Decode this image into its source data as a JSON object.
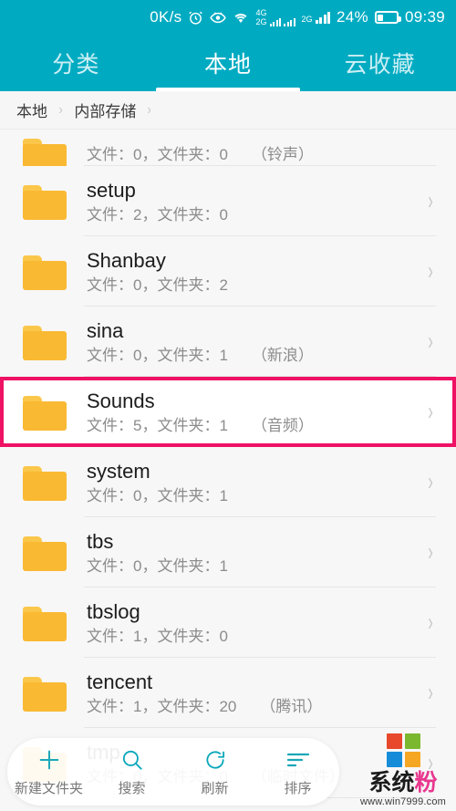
{
  "theme": {
    "accent_teal": "#00abc2",
    "folder_orange": "#f9b932",
    "highlight_pink": "#ee1164",
    "toolbar_teal": "#1aa7b8"
  },
  "statusbar": {
    "net_speed": "0K/s",
    "alarm_icon": "alarm-clock-icon",
    "eye_icon": "eye-care-icon",
    "wifi_icon": "wifi-icon",
    "sim1_label": "4G",
    "sim1_label2": "2G",
    "sim2_label": "2G",
    "battery_percent": "24%",
    "clock": "09:39"
  },
  "tabs": [
    {
      "label": "分类",
      "active": false
    },
    {
      "label": "本地",
      "active": true
    },
    {
      "label": "云收藏",
      "active": false
    }
  ],
  "breadcrumb": {
    "items": [
      "本地",
      "内部存储"
    ],
    "separator": "›"
  },
  "list": {
    "meta_prefix_files": "文件：",
    "meta_prefix_folders": "，文件夹：",
    "rows": [
      {
        "name": "",
        "files": "0",
        "folders": "0",
        "alias": "（铃声）",
        "partial": true,
        "highlight": false
      },
      {
        "name": "setup",
        "files": "2",
        "folders": "0",
        "alias": "",
        "partial": false,
        "highlight": false
      },
      {
        "name": "Shanbay",
        "files": "0",
        "folders": "2",
        "alias": "",
        "partial": false,
        "highlight": false
      },
      {
        "name": "sina",
        "files": "0",
        "folders": "1",
        "alias": "（新浪）",
        "partial": false,
        "highlight": false
      },
      {
        "name": "Sounds",
        "files": "5",
        "folders": "1",
        "alias": "（音频）",
        "partial": false,
        "highlight": true
      },
      {
        "name": "system",
        "files": "0",
        "folders": "1",
        "alias": "",
        "partial": false,
        "highlight": false
      },
      {
        "name": "tbs",
        "files": "0",
        "folders": "1",
        "alias": "",
        "partial": false,
        "highlight": false
      },
      {
        "name": "tbslog",
        "files": "1",
        "folders": "0",
        "alias": "",
        "partial": false,
        "highlight": false
      },
      {
        "name": "tencent",
        "files": "1",
        "folders": "20",
        "alias": "（腾讯）",
        "partial": false,
        "highlight": false
      },
      {
        "name": "tmp",
        "files": "0",
        "folders": "0",
        "alias": "（临时文件）",
        "partial": false,
        "highlight": false
      }
    ],
    "chevron": "›"
  },
  "toolbar": {
    "items": [
      {
        "label": "新建文件夹",
        "icon": "plus-icon"
      },
      {
        "label": "搜索",
        "icon": "search-icon"
      },
      {
        "label": "刷新",
        "icon": "refresh-icon"
      },
      {
        "label": "排序",
        "icon": "sort-icon"
      }
    ]
  },
  "watermark": {
    "text_dark": "系统",
    "text_pink": "粉",
    "url": "www.win7999.com",
    "square_colors": [
      "#e8482b",
      "#7cb82f",
      "#168cd8",
      "#f5a623"
    ]
  }
}
